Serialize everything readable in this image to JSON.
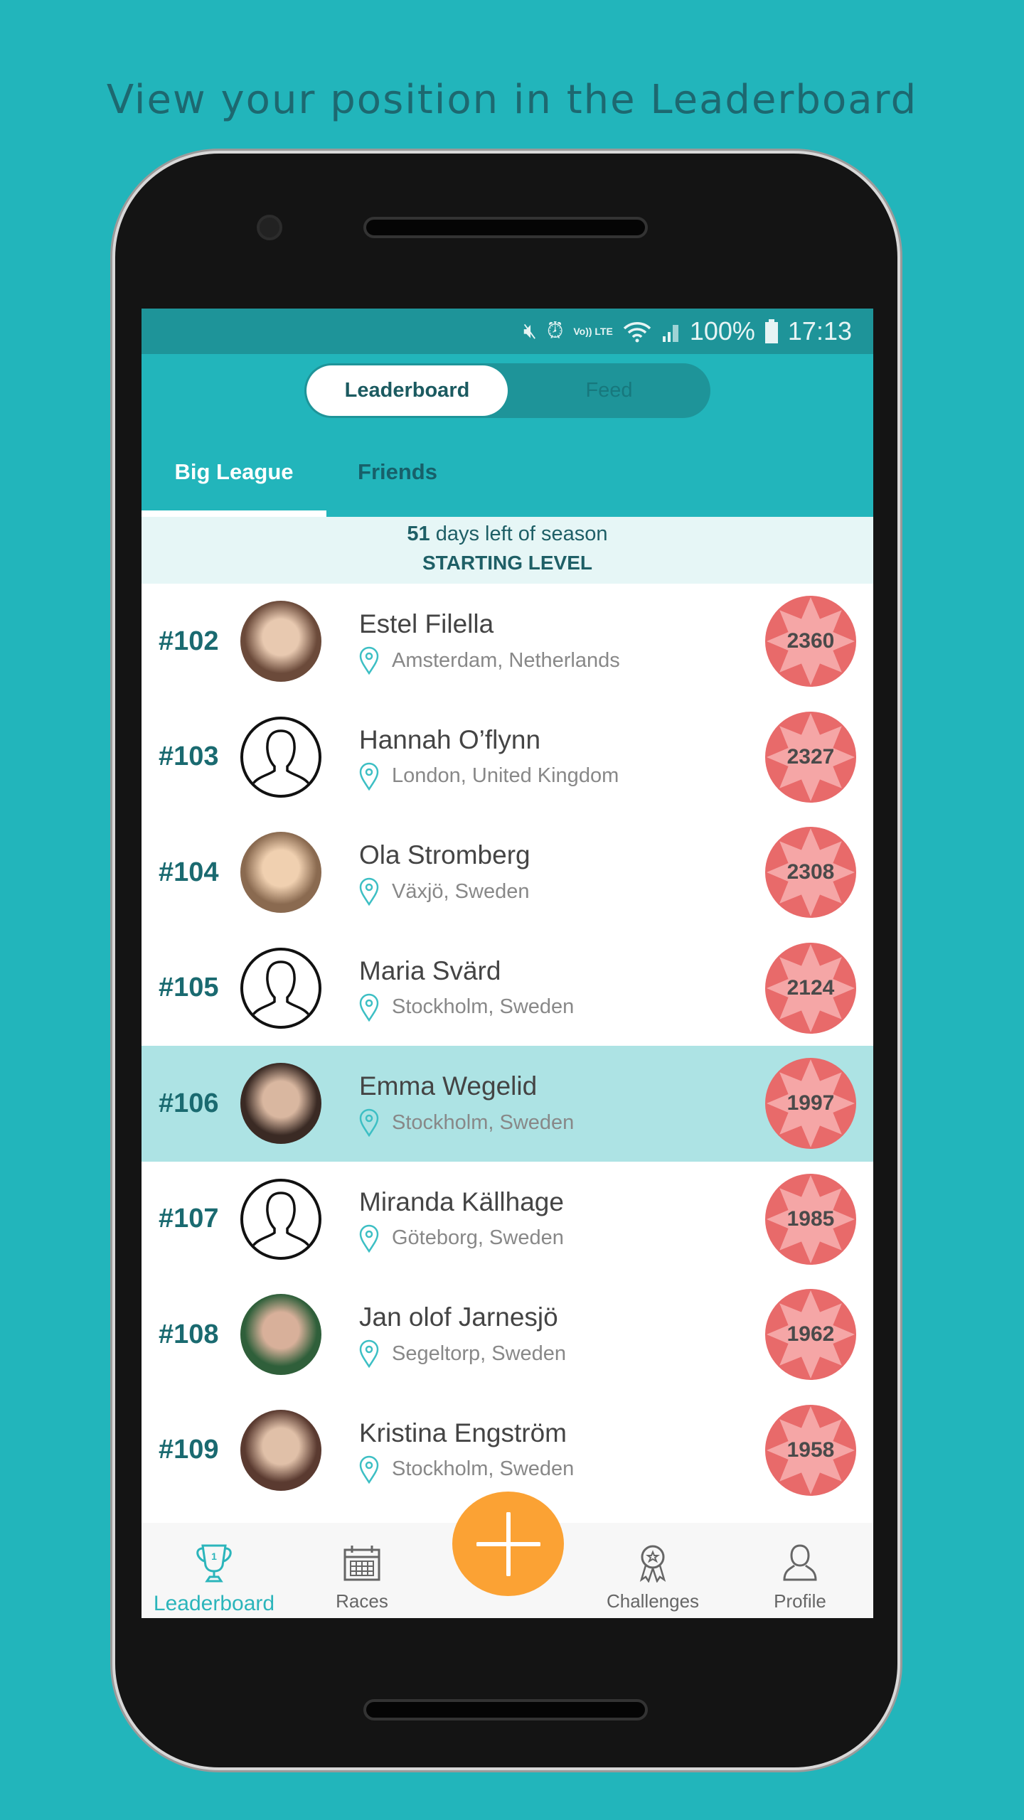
{
  "headline": "View your position in the Leaderboard",
  "status_bar": {
    "battery": "100%",
    "time": "17:13",
    "icons": [
      "mute-icon",
      "alarm-icon",
      "volte-icon",
      "wifi-icon",
      "signal-icon",
      "battery-icon"
    ],
    "volte_label": "Vo)) LTE"
  },
  "toggle": {
    "active": "Leaderboard",
    "inactive": "Feed"
  },
  "tabs": [
    {
      "label": "Big League",
      "active": true
    },
    {
      "label": "Friends",
      "active": false
    }
  ],
  "season": {
    "days": "51",
    "days_text": " days left of season",
    "level": "STARTING LEVEL"
  },
  "rows": [
    {
      "rank": "#102",
      "name": "Estel Filella",
      "location": "Amsterdam, Netherlands",
      "points": "2360",
      "photo": true,
      "highlight": false
    },
    {
      "rank": "#103",
      "name": "Hannah O’flynn",
      "location": "London, United Kingdom",
      "points": "2327",
      "photo": false,
      "highlight": false
    },
    {
      "rank": "#104",
      "name": "Ola Stromberg",
      "location": "Växjö, Sweden",
      "points": "2308",
      "photo": true,
      "highlight": false
    },
    {
      "rank": "#105",
      "name": "Maria Svärd",
      "location": "Stockholm, Sweden",
      "points": "2124",
      "photo": false,
      "highlight": false
    },
    {
      "rank": "#106",
      "name": "Emma Wegelid",
      "location": "Stockholm, Sweden",
      "points": "1997",
      "photo": true,
      "highlight": true
    },
    {
      "rank": "#107",
      "name": "Miranda Källhage",
      "location": "Göteborg, Sweden",
      "points": "1985",
      "photo": false,
      "highlight": false
    },
    {
      "rank": "#108",
      "name": "Jan olof Jarnesjö",
      "location": "Segeltorp, Sweden",
      "points": "1962",
      "photo": true,
      "highlight": false
    },
    {
      "rank": "#109",
      "name": "Kristina Engström",
      "location": "Stockholm, Sweden",
      "points": "1958",
      "photo": true,
      "highlight": false
    }
  ],
  "nav": [
    {
      "label": "Leaderboard",
      "icon": "trophy-icon",
      "active": true
    },
    {
      "label": "Races",
      "icon": "calendar-icon",
      "active": false
    },
    {
      "label": "Challenges",
      "icon": "award-icon",
      "active": false
    },
    {
      "label": "Profile",
      "icon": "person-icon",
      "active": false
    }
  ],
  "colors": {
    "background": "#22b5bb",
    "status": "#1e9499",
    "highlight": "#ade3e4",
    "badge": "#e86a6a",
    "fab": "#fba234",
    "rank": "#1a6a70"
  }
}
